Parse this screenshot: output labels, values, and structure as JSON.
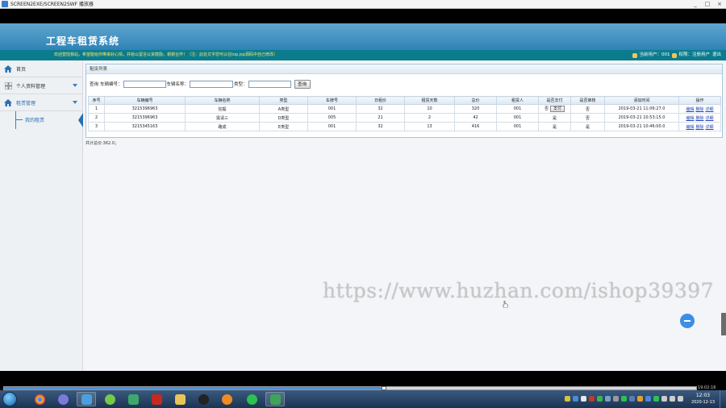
{
  "player": {
    "title": "SCREEN2EXE/SCREEN2SWF 播放器",
    "controls": [
      "_",
      "□",
      "×"
    ]
  },
  "app": {
    "title": "工程车租赁系统",
    "welcome": "欢迎登陆我站，希望能给你带来好心情，并给以留言以资鼓励，谢谢合作！（注：此处文字您可以在top.jsp源码中自己修改）",
    "current_user": "当前用户：001",
    "permission": "权限：注册用户",
    "logout": "退出"
  },
  "sidebar": {
    "home": "首页",
    "profile": "个人资料管理",
    "rental": "租赁管理",
    "my_rental": "我的租赁"
  },
  "panel": {
    "title": "租赁列表",
    "search_prefix": "查询",
    "vehicle_no_label": "车辆编号：",
    "vehicle_name_label": "车辆名称：",
    "type_label": "类型：",
    "search_button": "查询"
  },
  "table": {
    "headers": [
      "序号",
      "车辆编号",
      "车辆名称",
      "类型",
      "车牌号",
      "日租价",
      "租赁天数",
      "总价",
      "租赁人",
      "是否支付",
      "是否审核",
      "添加时间",
      "操作"
    ],
    "rows": [
      {
        "no": "1",
        "vehicle_no": "3215396963",
        "name": "挖掘",
        "type": "A类型",
        "plate": "001",
        "daily": "32",
        "days": "10",
        "total": "320",
        "renter": "001",
        "paid": "否",
        "pay_btn": "支付",
        "reviewed": "否",
        "time": "2019-03-21 11:06:27.0"
      },
      {
        "no": "2",
        "vehicle_no": "3215396963",
        "name": "需请三",
        "type": "D类型",
        "plate": "005",
        "daily": "21",
        "days": "2",
        "total": "42",
        "renter": "001",
        "paid": "是",
        "pay_btn": "",
        "reviewed": "否",
        "time": "2019-03-21 10:53:15.0"
      },
      {
        "no": "3",
        "vehicle_no": "3215345163",
        "name": "路成",
        "type": "E类型",
        "plate": "001",
        "daily": "32",
        "days": "13",
        "total": "416",
        "renter": "001",
        "paid": "是",
        "pay_btn": "",
        "reviewed": "是",
        "time": "2019-03-21 10:46:00.0"
      }
    ],
    "ops": [
      "编辑",
      "删除",
      "详细"
    ]
  },
  "total_text": "共计总价:362.0；",
  "watermark": "https://www.huzhan.com/ishop39397",
  "bottom": {
    "time_display": "19:02:16"
  },
  "taskbar": {
    "time": "12:03",
    "date": "2020-12-13"
  },
  "colors": {
    "header_blue": "#2f82b6",
    "teal_bar": "#0b7c8e",
    "welcome_yellow": "#ffe86a",
    "link_blue": "#2244bb"
  },
  "icons": {
    "home": "home-icon",
    "profile": "grid-icon",
    "rental": "home-icon"
  }
}
